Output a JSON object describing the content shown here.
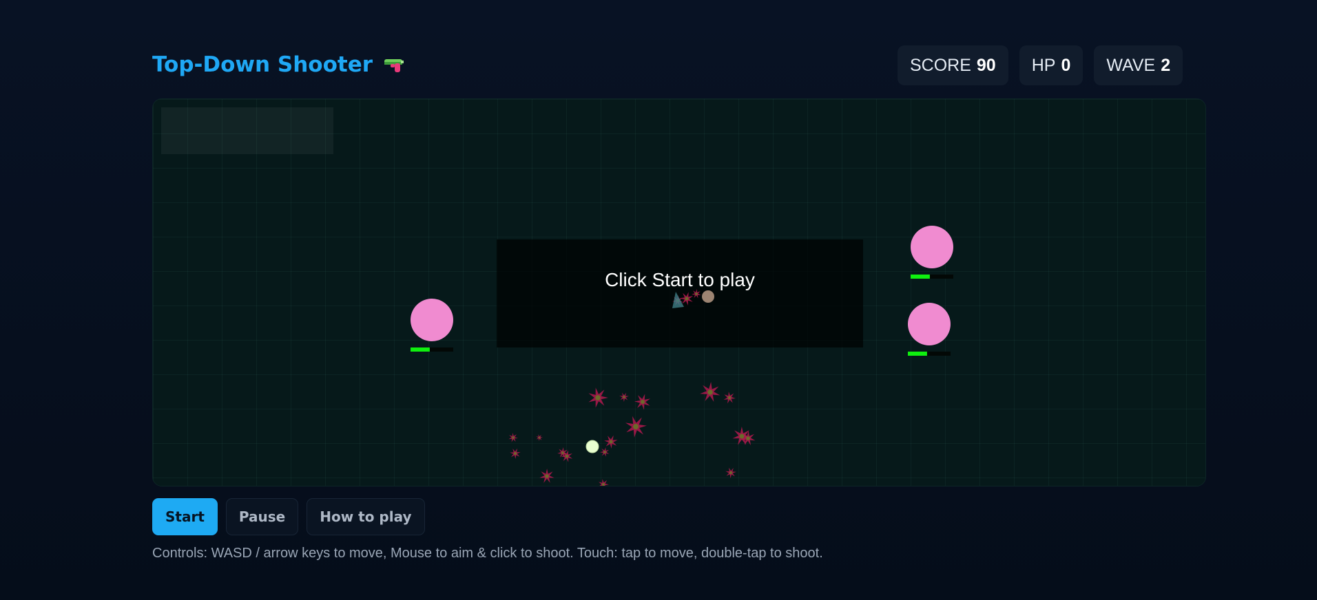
{
  "header": {
    "title": "Top-Down Shooter",
    "icon": "water-gun-icon"
  },
  "stats": {
    "score_label": "SCORE",
    "score_value": "90",
    "hp_label": "HP",
    "hp_value": "0",
    "wave_label": "WAVE",
    "wave_value": "2"
  },
  "game": {
    "overlay_text": "Click Start to play",
    "enemies": [
      {
        "health_fraction": 0.45
      },
      {
        "health_fraction": 0.45
      },
      {
        "health_fraction": 0.45
      }
    ],
    "colors": {
      "enemy": "#f08bd0",
      "health": "#0ff00f",
      "player": "#e8ffd0",
      "explosion": "#b3194f",
      "accent": "#1eaaf3"
    }
  },
  "controls": {
    "start_label": "Start",
    "pause_label": "Pause",
    "howto_label": "How to play"
  },
  "help_text": "Controls: WASD / arrow keys to move, Mouse to aim & click to shoot. Touch: tap to move, double-tap to shoot."
}
